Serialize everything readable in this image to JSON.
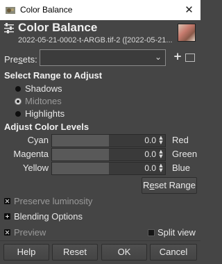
{
  "window": {
    "title": "Color Balance",
    "close_glyph": "✕"
  },
  "header": {
    "title": "Color Balance",
    "subtitle": "2022-05-21-0002-t-ARGB.tif-2 ([2022-05-21..."
  },
  "presets": {
    "label_pre": "Pre",
    "label_u": "s",
    "label_post": "ets:",
    "arrow": "⌄",
    "add_glyph": "+"
  },
  "range": {
    "title": "Select Range to Adjust",
    "options": [
      {
        "label": "Shadows",
        "selected": false
      },
      {
        "label": "Midtones",
        "selected": true
      },
      {
        "label": "Highlights",
        "selected": false
      }
    ]
  },
  "levels": {
    "title": "Adjust Color Levels",
    "rows": [
      {
        "left": "Cyan",
        "right": "Red",
        "value": "0.0",
        "fill_fraction": 0.5
      },
      {
        "left": "Magenta",
        "right": "Green",
        "value": "0.0",
        "fill_fraction": 0.5
      },
      {
        "left": "Yellow",
        "right": "Blue",
        "value": "0.0",
        "fill_fraction": 0.5
      }
    ],
    "reset_range_pre": "R",
    "reset_range_u": "e",
    "reset_range_post": "set Range"
  },
  "options": {
    "preserve_luminosity": "Preserve luminosity",
    "blending_options": "Blending Options",
    "preview": "Preview",
    "split_view": "Split view"
  },
  "buttons": {
    "help": "Help",
    "reset": "Reset",
    "ok": "OK",
    "cancel": "Cancel"
  },
  "colors": {
    "background": "#454545",
    "titlebar": "#ffffff",
    "slider_fill": "#595959"
  }
}
